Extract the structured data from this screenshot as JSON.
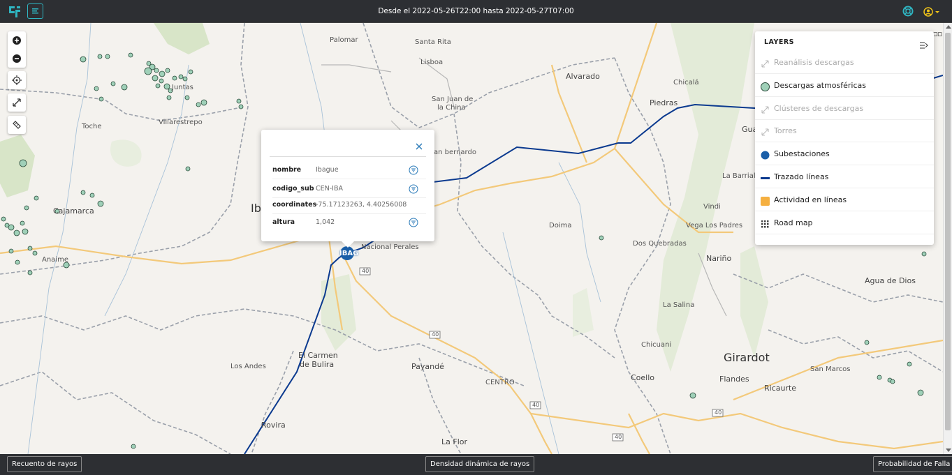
{
  "topbar": {
    "title": "Desde el 2022-05-26T22:00 hasta 2022-05-27T07:00"
  },
  "map": {
    "labels": [
      {
        "text": "Palomar",
        "cls": ""
      },
      {
        "text": "Santa Rita",
        "cls": ""
      },
      {
        "text": "Lisboa",
        "cls": ""
      },
      {
        "text": "Alvarado",
        "cls": "med"
      },
      {
        "text": "Chicalá",
        "cls": ""
      },
      {
        "text": "Piedras",
        "cls": "med"
      },
      {
        "text": "San Juan de",
        "cls": ""
      },
      {
        "text": "la China",
        "cls": ""
      },
      {
        "text": "Juntas",
        "cls": ""
      },
      {
        "text": "Villarestrepo",
        "cls": ""
      },
      {
        "text": "Toche",
        "cls": ""
      },
      {
        "text": "an bernardo",
        "cls": ""
      },
      {
        "text": "Gua",
        "cls": "med"
      },
      {
        "text": "La Barrialo",
        "cls": ""
      },
      {
        "text": "Cajamarca",
        "cls": "med"
      },
      {
        "text": "Ib",
        "cls": "big"
      },
      {
        "text": "Vindi",
        "cls": ""
      },
      {
        "text": "Doima",
        "cls": ""
      },
      {
        "text": "Vega Los Padres",
        "cls": ""
      },
      {
        "text": "Nacional Perales",
        "cls": ""
      },
      {
        "text": "Dos Quebradas",
        "cls": ""
      },
      {
        "text": "Anaime",
        "cls": ""
      },
      {
        "text": "Nariño",
        "cls": "med"
      },
      {
        "text": "Agua de Dios",
        "cls": "med"
      },
      {
        "text": "La Salina",
        "cls": ""
      },
      {
        "text": "Chicuani",
        "cls": ""
      },
      {
        "text": "El Carmen",
        "cls": "med"
      },
      {
        "text": "de Bulira",
        "cls": "med"
      },
      {
        "text": "Girardot",
        "cls": "big"
      },
      {
        "text": "Los Andes",
        "cls": ""
      },
      {
        "text": "Payandé",
        "cls": "med"
      },
      {
        "text": "San Marcos",
        "cls": ""
      },
      {
        "text": "Coello",
        "cls": "med"
      },
      {
        "text": "Flandes",
        "cls": "med"
      },
      {
        "text": "Ricaurte",
        "cls": "med"
      },
      {
        "text": "CENTRO",
        "cls": ""
      },
      {
        "text": "Rovira",
        "cls": "med"
      },
      {
        "text": "La Flor",
        "cls": "med"
      }
    ],
    "road_shields": [
      "40",
      "40",
      "40",
      "40",
      "40"
    ],
    "substation_label": "IBAG",
    "colors": {
      "line": "#0b3a8f",
      "substation": "#1a5fa8",
      "strike_fill": "#9fd0b8",
      "strike_stroke": "#2a4a3a",
      "activity": "#f5b041"
    }
  },
  "popup": {
    "rows": [
      {
        "key": "nombre",
        "value": "Ibague",
        "filter": true
      },
      {
        "key": "codigo_sub",
        "value": "CEN-IBA",
        "filter": true
      },
      {
        "key": "coordinates",
        "value": "-75.17123263, 4.40256008",
        "filter": false
      },
      {
        "key": "altura",
        "value": "1,042",
        "filter": true
      }
    ]
  },
  "layers": {
    "title": "LAYERS",
    "items": [
      {
        "label": "Reanálisis descargas",
        "icon": "expand-arrow-icon",
        "enabled": false
      },
      {
        "label": "Descargas atmosféricas",
        "icon": "green-circle-icon",
        "enabled": true
      },
      {
        "label": "Clústeres de descargas",
        "icon": "expand-arrow-icon",
        "enabled": false
      },
      {
        "label": "Torres",
        "icon": "expand-arrow-icon",
        "enabled": false
      },
      {
        "label": "Subestaciones",
        "icon": "blue-circle-icon",
        "enabled": true
      },
      {
        "label": "Trazado líneas",
        "icon": "blue-line-icon",
        "enabled": true
      },
      {
        "label": "Actividad en líneas",
        "icon": "orange-square-icon",
        "enabled": true
      },
      {
        "label": "Road map",
        "icon": "grid-icon",
        "enabled": true
      }
    ]
  },
  "bottombar": {
    "left_button": "Recuento de rayos",
    "center_button": "Densidad dinámica de rayos",
    "right_button": "Probabilidad de Falla"
  }
}
